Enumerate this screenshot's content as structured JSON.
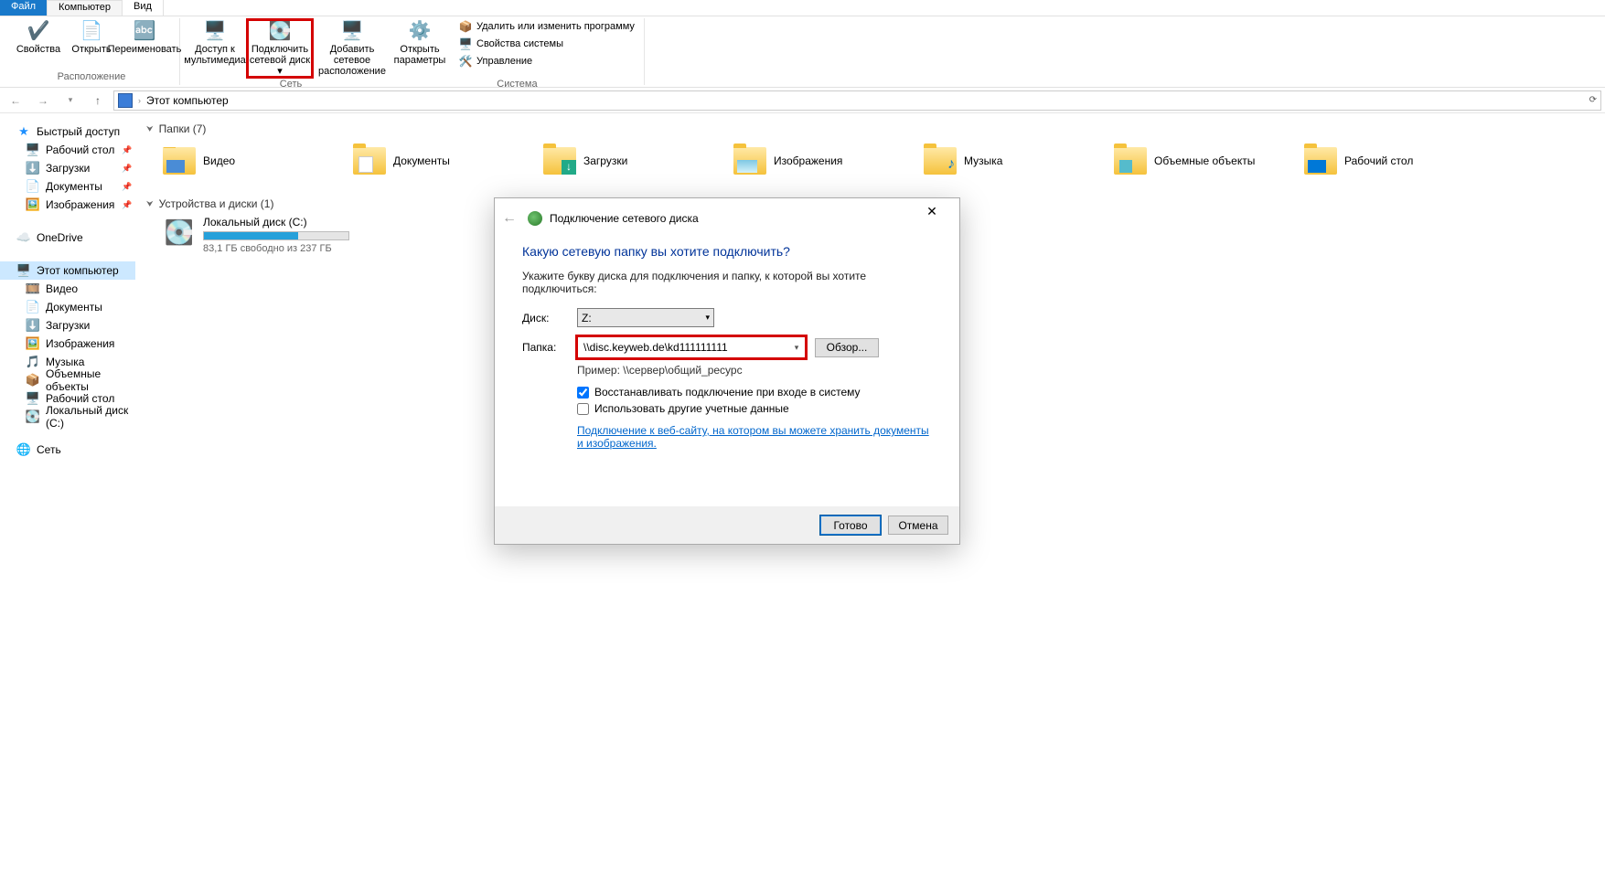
{
  "tabs": {
    "file": "Файл",
    "computer": "Компьютер",
    "view": "Вид"
  },
  "ribbon": {
    "group_location": {
      "label": "Расположение",
      "properties": "Свойства",
      "open": "Открыть",
      "rename": "Переименовать"
    },
    "group_network": {
      "label": "Сеть",
      "media": "Доступ к мультимедиа",
      "map_drive": "Подключить сетевой диск ▾",
      "add_loc": "Добавить сетевое расположение",
      "open_params": "Открыть параметры"
    },
    "group_system": {
      "label": "Система",
      "uninstall": "Удалить или изменить программу",
      "sys_props": "Свойства системы",
      "manage": "Управление"
    }
  },
  "address": "Этот компьютер",
  "sidebar": {
    "quick": "Быстрый доступ",
    "desktop": "Рабочий стол",
    "downloads": "Загрузки",
    "documents": "Документы",
    "pictures": "Изображения",
    "onedrive": "OneDrive",
    "thispc": "Этот компьютер",
    "videos": "Видео",
    "music": "Музыка",
    "objects3d": "Объемные объекты",
    "cdrive": "Локальный диск (C:)",
    "network": "Сеть"
  },
  "content": {
    "folders_hdr": "Папки (7)",
    "devices_hdr": "Устройства и диски (1)",
    "folders": {
      "videos": "Видео",
      "documents": "Документы",
      "downloads": "Загрузки",
      "pictures": "Изображения",
      "music": "Музыка",
      "objects3d": "Объемные объекты",
      "desktop": "Рабочий стол"
    },
    "drive": {
      "name": "Локальный диск (C:)",
      "sub": "83,1 ГБ свободно из 237 ГБ"
    }
  },
  "dialog": {
    "title": "Подключение сетевого диска",
    "heading": "Какую сетевую папку вы хотите подключить?",
    "instr": "Укажите букву диска для подключения и папку, к которой вы хотите подключиться:",
    "drive_label": "Диск:",
    "drive_value": "Z:",
    "folder_label": "Папка:",
    "folder_value": "\\\\disc.keyweb.de\\kd111111111",
    "browse": "Обзор...",
    "example": "Пример: \\\\сервер\\общий_ресурс",
    "reconnect": "Восстанавливать подключение при входе в систему",
    "other_creds": "Использовать другие учетные данные",
    "link": "Подключение к веб-сайту, на котором вы можете хранить документы и изображения",
    "ok": "Готово",
    "cancel": "Отмена"
  }
}
